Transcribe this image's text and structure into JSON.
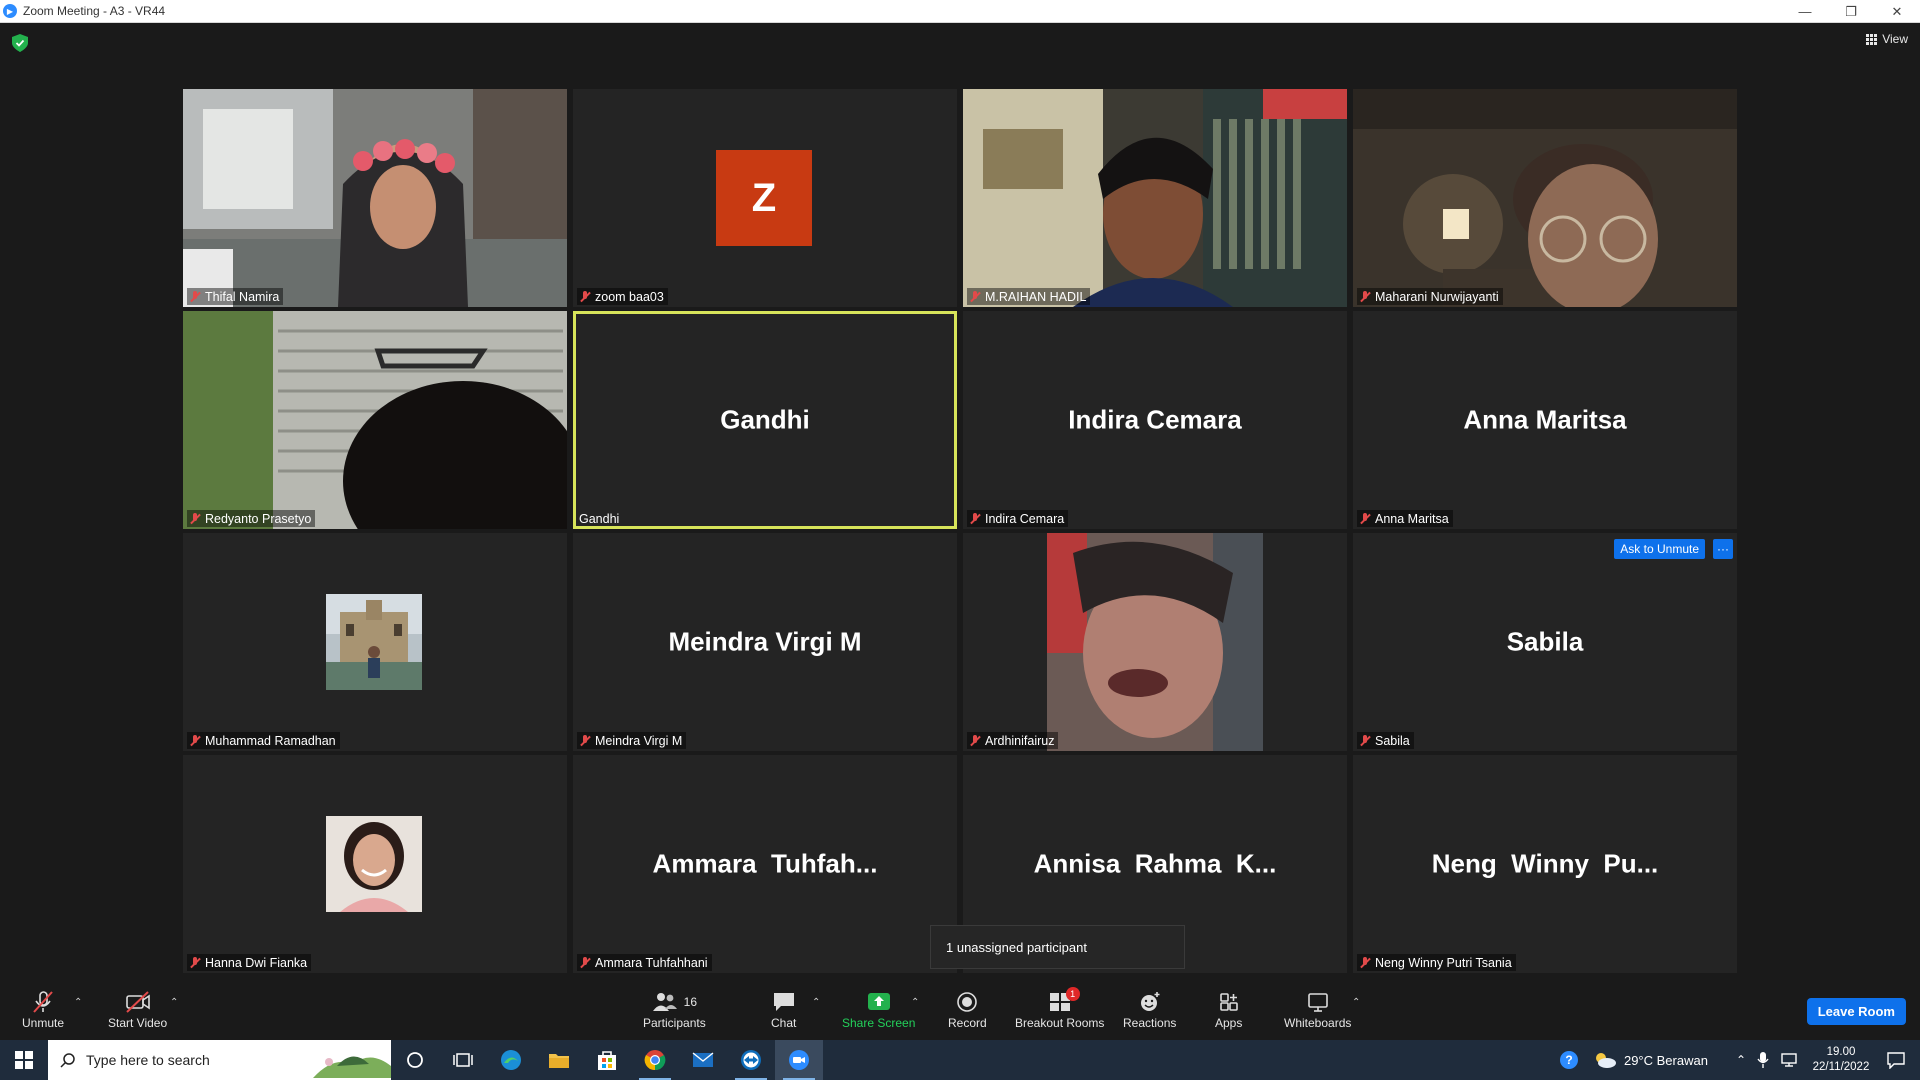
{
  "window": {
    "title": "Zoom Meeting - A3 - VR44"
  },
  "meeting": {
    "view_label": "View",
    "tiles": [
      {
        "display": "video",
        "name": "Thifal Namira",
        "muted": true
      },
      {
        "display": "avatar",
        "avatar_letter": "Z",
        "name": "zoom baa03",
        "muted": true
      },
      {
        "display": "video",
        "name": "M.RAIHAN HADIL",
        "muted": true
      },
      {
        "display": "video",
        "name": "Maharani Nurwijayanti",
        "muted": true
      },
      {
        "display": "video",
        "name": "Redyanto Prasetyo",
        "muted": true
      },
      {
        "display": "name",
        "big_name": "Gandhi",
        "name": "Gandhi",
        "muted": false,
        "active_speaker": true
      },
      {
        "display": "name",
        "big_name": "Indira Cemara",
        "name": "Indira Cemara",
        "muted": true
      },
      {
        "display": "name",
        "big_name": "Anna Maritsa",
        "name": "Anna Maritsa",
        "muted": true
      },
      {
        "display": "photo",
        "name": "Muhammad Ramadhan",
        "muted": true
      },
      {
        "display": "name",
        "big_name": "Meindra Virgi M",
        "name": "Meindra Virgi M",
        "muted": true
      },
      {
        "display": "video",
        "name": "Ardhinifairuz",
        "muted": true
      },
      {
        "display": "name",
        "big_name": "Sabila",
        "name": "Sabila",
        "muted": true,
        "ask_to_unmute": "Ask to Unmute",
        "more": "···"
      },
      {
        "display": "photo",
        "name": "Hanna Dwi Fianka",
        "muted": true
      },
      {
        "display": "name",
        "big_name": "Ammara  Tuhfah...",
        "name": "Ammara Tuhfahhani",
        "muted": true
      },
      {
        "display": "name",
        "big_name": "Annisa  Rahma  K...",
        "name": "",
        "muted": false
      },
      {
        "display": "name",
        "big_name": "Neng  Winny  Pu...",
        "name": "Neng Winny Putri Tsania",
        "muted": true
      }
    ],
    "unassigned_popup": "1 unassigned participant"
  },
  "toolbar": {
    "unmute": "Unmute",
    "start_video": "Start Video",
    "participants": "Participants",
    "participants_count": "16",
    "chat": "Chat",
    "share_screen": "Share Screen",
    "record": "Record",
    "breakout_rooms": "Breakout Rooms",
    "breakout_badge": "1",
    "reactions": "Reactions",
    "apps": "Apps",
    "whiteboards": "Whiteboards",
    "leave": "Leave Room",
    "colors": {
      "accent": "#0e71eb",
      "share_green": "#23b14d",
      "active_speaker": "#d7e45a",
      "muted_red": "#e24a4a"
    }
  },
  "taskbar": {
    "search_placeholder": "Type here to search",
    "weather": "29°C  Berawan",
    "time": "19.00",
    "date": "22/11/2022",
    "apps": [
      "cortana-icon",
      "task-view-icon",
      "edge-icon",
      "file-explorer-icon",
      "store-icon",
      "chrome-icon",
      "mail-icon",
      "teamviewer-icon",
      "zoom-icon"
    ]
  }
}
